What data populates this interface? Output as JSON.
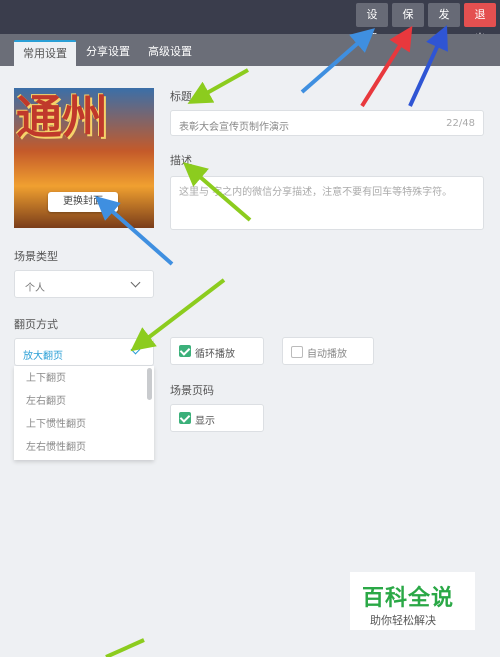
{
  "topbar": {
    "settings": "设置",
    "save": "保存",
    "publish": "发布",
    "exit": "退出"
  },
  "tabs": [
    "常用设置",
    "分享设置",
    "高级设置"
  ],
  "cover": {
    "text_chars": [
      "通",
      "州",
      "",
      "",
      "",
      ""
    ],
    "change_label": "更换封面"
  },
  "title_field": {
    "label": "标题",
    "value": "表彰大会宣传页制作演示",
    "counter": "22/48"
  },
  "desc_field": {
    "label": "描述",
    "value": "这里与 字之内的微信分享描述，注意不要有回车等特殊字符。"
  },
  "scene_type": {
    "label": "场景类型",
    "value": "个人"
  },
  "page_flip": {
    "label": "翻页方式",
    "value": "放大翻页",
    "options": [
      "上下翻页",
      "左右翻页",
      "上下惯性翻页",
      "左右惯性翻页"
    ]
  },
  "loop_play": {
    "label": "循环播放",
    "checked": true
  },
  "auto_play": {
    "label": "自动播放",
    "checked": false
  },
  "page_number": {
    "label": "场景页码",
    "option_label": "显示",
    "checked": true
  },
  "watermark": {
    "title": "百科全说",
    "subtitle": "助你轻松解决"
  },
  "colors": {
    "topbar": "#3a3d4c",
    "exit": "#e45050",
    "accent": "#2a9fd6",
    "check": "#3bb07a",
    "arrow_green": "#8ccc1e",
    "arrow_blue": "#3f8fe0",
    "arrow_red": "#e8383d",
    "arrow_navy": "#2f55d4"
  }
}
